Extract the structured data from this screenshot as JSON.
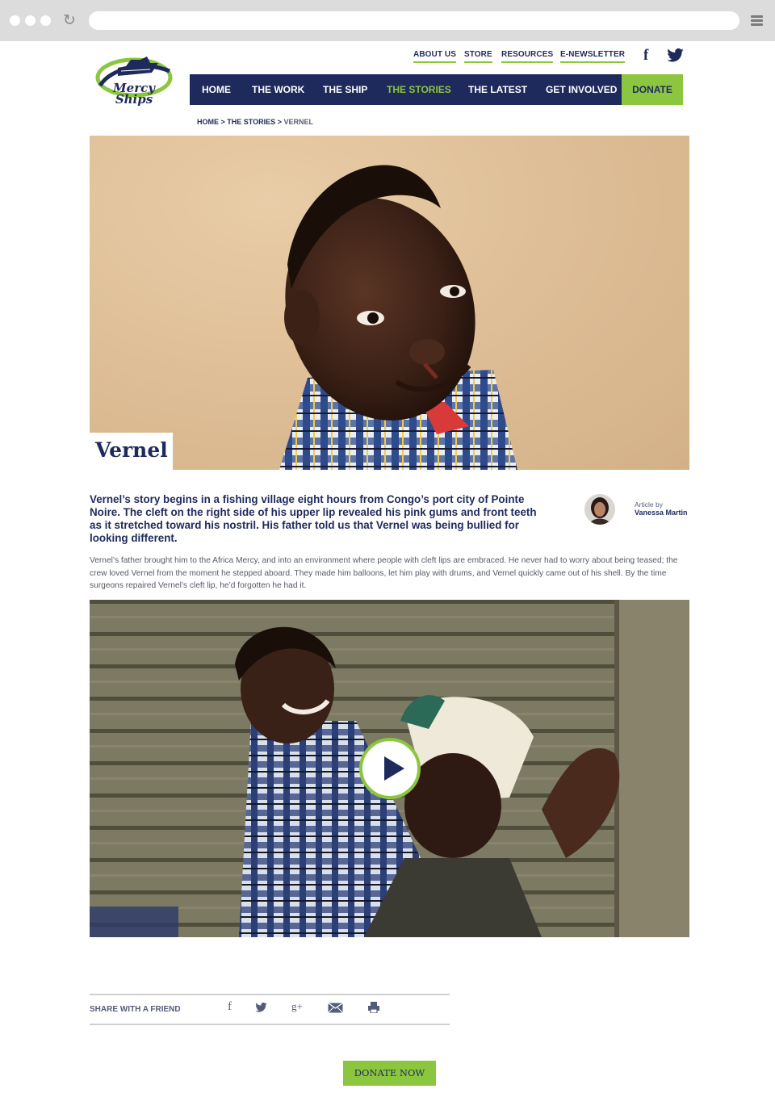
{
  "browser": {
    "reload_icon": "reload-icon",
    "menu_icon": "hamburger-menu-icon"
  },
  "logo": {
    "line1": "Mercy",
    "line2": "Ships"
  },
  "utility_nav": [
    {
      "label": "ABOUT US"
    },
    {
      "label": "STORE"
    },
    {
      "label": "RESOURCES"
    },
    {
      "label": "E-NEWSLETTER"
    }
  ],
  "social": {
    "facebook_glyph": "f",
    "twitter_icon": "twitter-bird-icon"
  },
  "main_nav": {
    "items": [
      {
        "label": "HOME"
      },
      {
        "label": "THE WORK"
      },
      {
        "label": "THE SHIP"
      },
      {
        "label": "THE STORIES"
      },
      {
        "label": "THE LATEST"
      },
      {
        "label": "GET INVOLVED"
      }
    ],
    "active": "THE STORIES",
    "donate_label": "DONATE"
  },
  "breadcrumb": {
    "home": "HOME",
    "section": "THE STORIES",
    "separator": ">",
    "current": "VERNEL"
  },
  "hero": {
    "title": "Vernel"
  },
  "article": {
    "intro": "Vernel’s story begins in a fishing village eight hours from Congo’s port city of Pointe Noire. The cleft on the right side of his upper lip revealed his pink gums and front teeth as it stretched toward his nostril. His father told us that Vernel was being bullied for looking different.",
    "body": "Vernel’s father brought him to the Africa Mercy, and into an environment where people with cleft lips are embraced. He never had to worry about being teased; the crew loved Vernel from the moment he stepped aboard. They made him balloons, let him play with drums, and Vernel quickly came out of his shell. By the time surgeons repaired Vernel’s cleft lip, he’d forgotten he had it.",
    "author_label": "Article by",
    "author_name": "Vanessa Martin"
  },
  "share": {
    "label": "SHARE WITH A FRIEND",
    "facebook_glyph": "f",
    "googleplus_glyph": "g+"
  },
  "cta": {
    "donate_now": "DONATE NOW"
  },
  "colors": {
    "navy": "#1f2a5c",
    "green": "#8cc63f"
  }
}
